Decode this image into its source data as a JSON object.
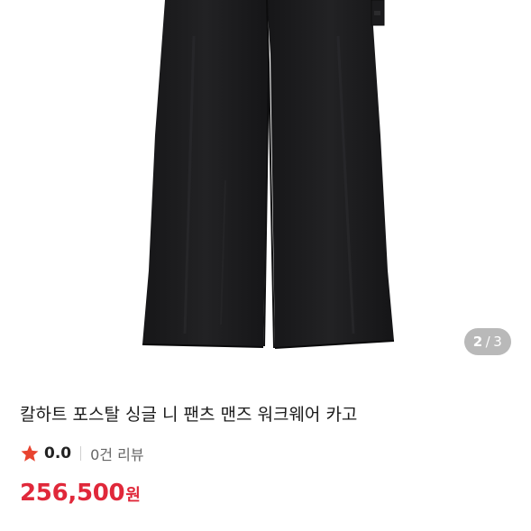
{
  "gallery": {
    "current": "2",
    "separator": "/",
    "total": "3",
    "image_icon": "black-cargo-pants-photo"
  },
  "product": {
    "title": "칼하트 포스탈 싱글 니 팬츠 맨즈 워크웨어 카고",
    "rating": "0.0",
    "review_count": "0건 리뷰",
    "price": "256,500",
    "price_unit": "원",
    "star_icon": "star-icon"
  },
  "colors": {
    "price": "#e0283a",
    "star": "#e8432f",
    "pants": "#1c1c1e",
    "counter_bg": "#afafaf"
  }
}
